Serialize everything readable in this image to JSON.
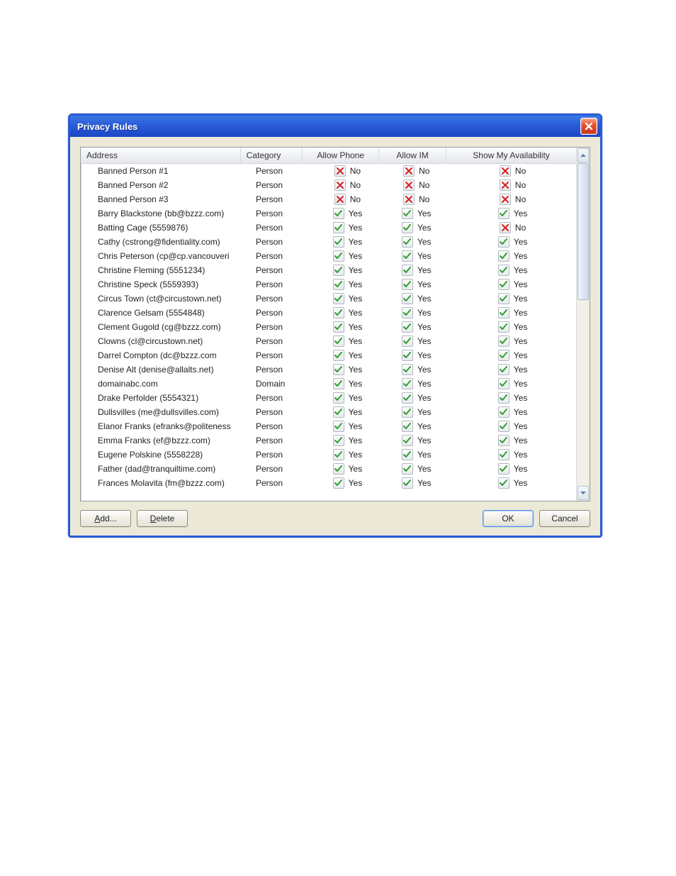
{
  "window": {
    "title": "Privacy Rules"
  },
  "columns": {
    "address": "Address",
    "category": "Category",
    "allow_phone": "Allow Phone",
    "allow_im": "Allow IM",
    "show_avail": "Show My Availability"
  },
  "yn": {
    "yes": "Yes",
    "no": "No"
  },
  "rows": [
    {
      "address": "Banned Person #1",
      "category": "Person",
      "phone": false,
      "im": false,
      "avail": false
    },
    {
      "address": "Banned Person #2",
      "category": "Person",
      "phone": false,
      "im": false,
      "avail": false
    },
    {
      "address": "Banned Person #3",
      "category": "Person",
      "phone": false,
      "im": false,
      "avail": false
    },
    {
      "address": "Barry Blackstone (bb@bzzz.com)",
      "category": "Person",
      "phone": true,
      "im": true,
      "avail": true
    },
    {
      "address": "Batting Cage (5559876)",
      "category": "Person",
      "phone": true,
      "im": true,
      "avail": false
    },
    {
      "address": "Cathy (cstrong@fidentiality.com)",
      "category": "Person",
      "phone": true,
      "im": true,
      "avail": true
    },
    {
      "address": "Chris Peterson (cp@cp.vancouveri",
      "category": "Person",
      "phone": true,
      "im": true,
      "avail": true
    },
    {
      "address": "Christine Fleming (5551234)",
      "category": "Person",
      "phone": true,
      "im": true,
      "avail": true
    },
    {
      "address": "Christine Speck (5559393)",
      "category": "Person",
      "phone": true,
      "im": true,
      "avail": true
    },
    {
      "address": "Circus Town (ct@circustown.net)",
      "category": "Person",
      "phone": true,
      "im": true,
      "avail": true
    },
    {
      "address": "Clarence Gelsam (5554848)",
      "category": "Person",
      "phone": true,
      "im": true,
      "avail": true
    },
    {
      "address": "Clement Gugold (cg@bzzz.com)",
      "category": "Person",
      "phone": true,
      "im": true,
      "avail": true
    },
    {
      "address": "Clowns (cl@circustown.net)",
      "category": "Person",
      "phone": true,
      "im": true,
      "avail": true
    },
    {
      "address": "Darrel Compton (dc@bzzz.com",
      "category": "Person",
      "phone": true,
      "im": true,
      "avail": true
    },
    {
      "address": "Denise Alt (denise@allalts.net)",
      "category": "Person",
      "phone": true,
      "im": true,
      "avail": true
    },
    {
      "address": "domainabc.com",
      "category": "Domain",
      "phone": true,
      "im": true,
      "avail": true
    },
    {
      "address": "Drake Perfolder (5554321)",
      "category": "Person",
      "phone": true,
      "im": true,
      "avail": true
    },
    {
      "address": "Dullsvilles (me@dullsvilles.com)",
      "category": "Person",
      "phone": true,
      "im": true,
      "avail": true
    },
    {
      "address": "Elanor Franks (efranks@politeness",
      "category": "Person",
      "phone": true,
      "im": true,
      "avail": true
    },
    {
      "address": "Emma Franks (ef@bzzz.com)",
      "category": "Person",
      "phone": true,
      "im": true,
      "avail": true
    },
    {
      "address": "Eugene Polskine (5558228)",
      "category": "Person",
      "phone": true,
      "im": true,
      "avail": true
    },
    {
      "address": "Father (dad@tranquiltime.com)",
      "category": "Person",
      "phone": true,
      "im": true,
      "avail": true
    },
    {
      "address": "Frances Molavita (fm@bzzz.com)",
      "category": "Person",
      "phone": true,
      "im": true,
      "avail": true
    }
  ],
  "buttons": {
    "add": "Add...",
    "add_mn": "A",
    "delete": "Delete",
    "delete_mn": "D",
    "ok": "OK",
    "cancel": "Cancel"
  }
}
